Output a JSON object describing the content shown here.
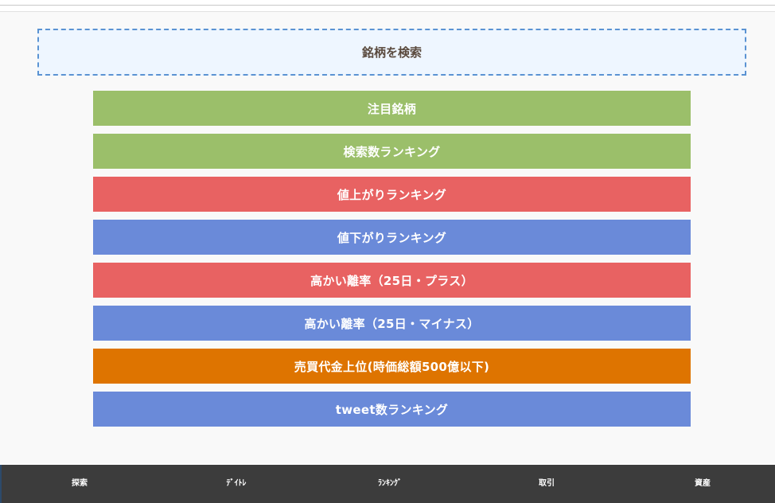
{
  "search": {
    "label": "銘柄を検索",
    "border_color": "#5b93d3",
    "bg_color": "#eef6ff"
  },
  "menu": [
    {
      "label": "注目銘柄",
      "color": "#9bbf6a"
    },
    {
      "label": "検索数ランキング",
      "color": "#9bbf6a"
    },
    {
      "label": "値上がりランキング",
      "color": "#e86262"
    },
    {
      "label": "値下がりランキング",
      "color": "#6a8ad9"
    },
    {
      "label": "高かい離率（25日・プラス）",
      "color": "#e86262"
    },
    {
      "label": "高かい離率（25日・マイナス）",
      "color": "#6a8ad9"
    },
    {
      "label": "売買代金上位(時価総額500億以下)",
      "color": "#de7400"
    },
    {
      "label": "tweet数ランキング",
      "color": "#6a8ad9"
    }
  ],
  "bottom_nav": [
    {
      "label": "探索"
    },
    {
      "label": "ﾃﾞｲﾄﾚ"
    },
    {
      "label": "ﾗﾝｷﾝｸﾞ"
    },
    {
      "label": "取引"
    },
    {
      "label": "資産"
    }
  ],
  "colors": {
    "nav_bg": "#3c3c3c",
    "content_bg": "#f9f9f9"
  }
}
